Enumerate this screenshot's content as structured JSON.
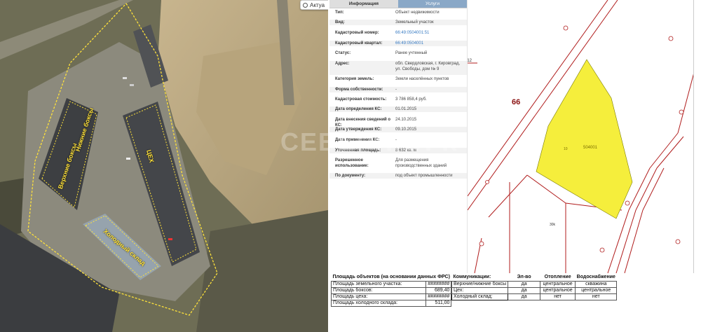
{
  "satellite": {
    "actual_button_label": "Актуа",
    "labels": {
      "boxes_upper": "Верхние боксы",
      "boxes_lower": "Нижние боксы",
      "workshop": "ЦЕХ",
      "cold_storage": "Холодный склад"
    }
  },
  "info_panel": {
    "tabs": [
      {
        "label": "Информация",
        "active": true
      },
      {
        "label": "Услуги",
        "active": false
      }
    ],
    "rows": [
      {
        "key": "Тип:",
        "value": "Объект недвижимости"
      },
      {
        "key": "Вид:",
        "value": "Земельный участок"
      },
      {
        "key": "Кадастровый номер:",
        "value": "66:49:0504001:51"
      },
      {
        "key": "Кадастровый квартал:",
        "value": "66:49:0504001"
      },
      {
        "key": "Статус:",
        "value": "Ранее учтенный"
      },
      {
        "key": "Адрес:",
        "value": "обл. Свердловская, г. Кировград, ул. Свободы, дом № 9"
      },
      {
        "key": "Категория земель:",
        "value": "Земли населённых пунктов"
      },
      {
        "key": "Форма собственности:",
        "value": "-"
      },
      {
        "key": "Кадастровая стоимость:",
        "value": "3 786 858,4 руб."
      },
      {
        "key": "Дата определения КС:",
        "value": "01.01.2015"
      },
      {
        "key": "Дата внесения сведений о КС:",
        "value": "24.10.2015"
      },
      {
        "key": "Дата утверждения КС:",
        "value": "09.10.2015"
      },
      {
        "key": "Дата применения КС:",
        "value": "-"
      },
      {
        "key": "Уточненная площадь:",
        "value": "8 632 кв. м"
      },
      {
        "key": "Разрешенное использование:",
        "value": "Для размещения производственных зданий"
      },
      {
        "key": "По документу:",
        "value": "под объект промышленности"
      }
    ],
    "watermark": "СЕВЕРНАЯ К"
  },
  "cadastral_map": {
    "label_66": "66",
    "label_012": "012",
    "label_parcel": "504001",
    "label_parcel_small": "10",
    "label_bottom": "30k",
    "colors": {
      "boundary": "#b01c1c",
      "parcel_fill": "#f5ee3c"
    }
  },
  "areas_table": {
    "title": "Площадь объектов (на основании данных ФРС)",
    "rows": [
      {
        "label": "Площадь земельного участка:",
        "value": "########"
      },
      {
        "label": "Площадь боксов:",
        "value": "689,40"
      },
      {
        "label": "Площадь цеха:",
        "value": "########"
      },
      {
        "label": "Площадь холодного склада:",
        "value": "511,00"
      }
    ]
  },
  "utilities_table": {
    "headers": [
      "Коммуникации:",
      "Эл-во",
      "Отопление",
      "Водоснабжение"
    ],
    "rows": [
      {
        "name": "Верхние/нижние боксы",
        "electricity": "да",
        "heating": "центральное",
        "water": "скважина"
      },
      {
        "name": "Цех:",
        "electricity": "да",
        "heating": "центральное",
        "water": "центральное"
      },
      {
        "name": "Холодный склад:",
        "electricity": "да",
        "heating": "нет",
        "water": "нет"
      }
    ]
  }
}
